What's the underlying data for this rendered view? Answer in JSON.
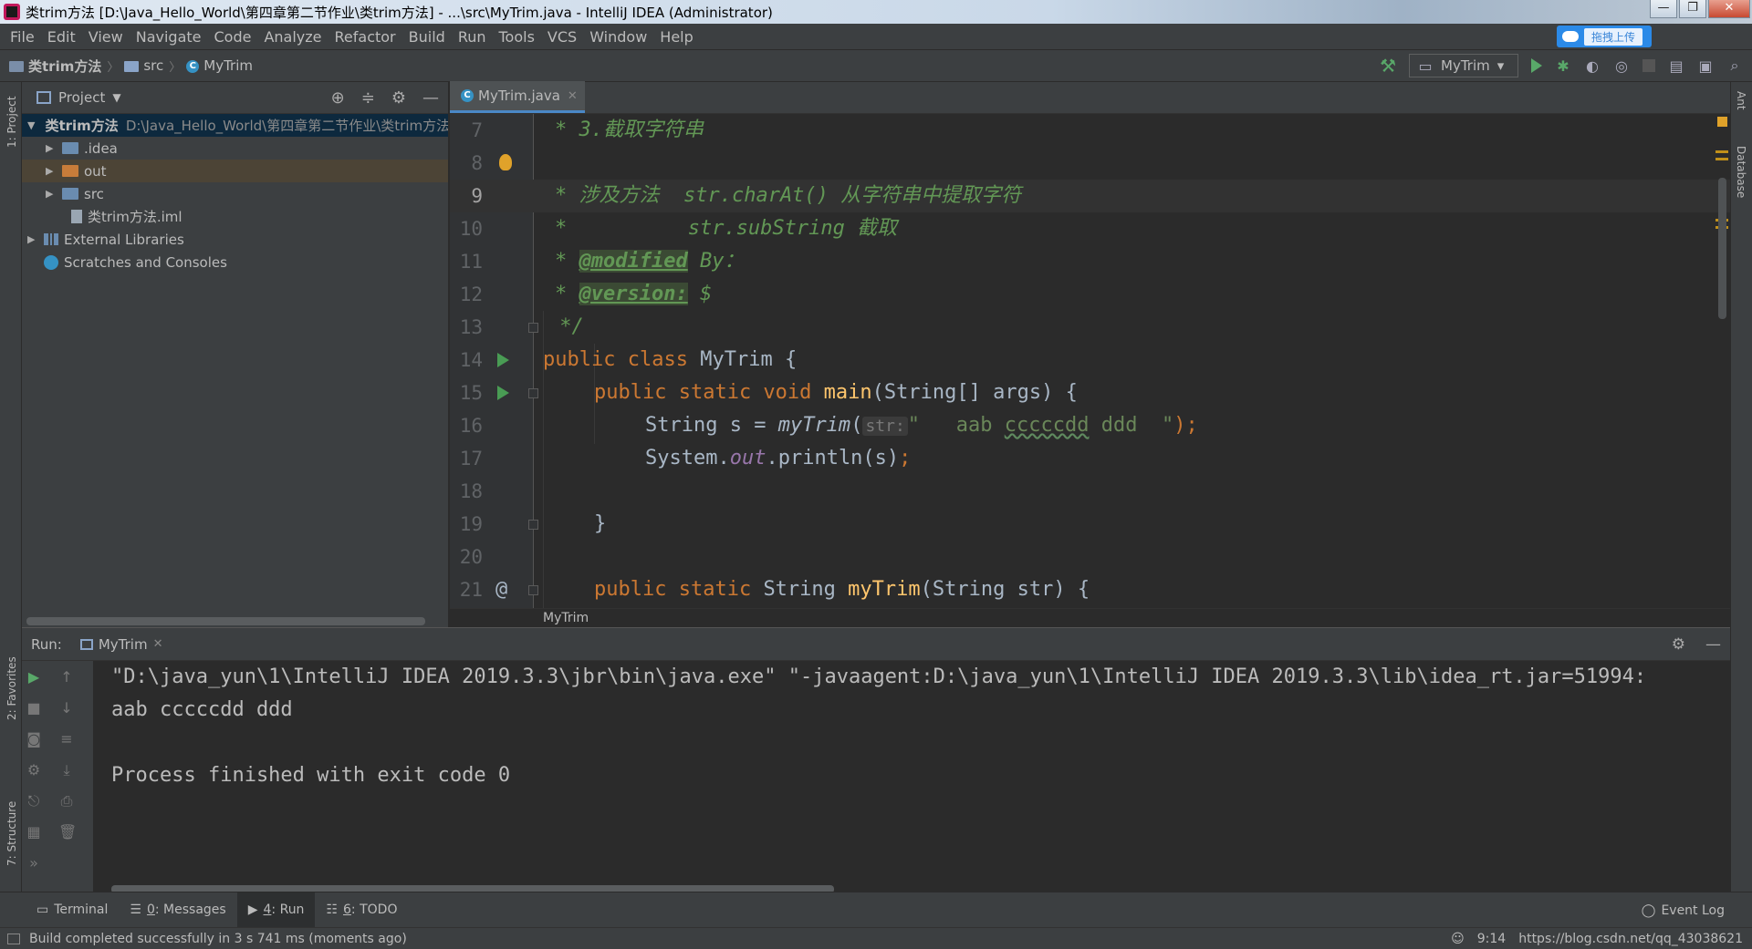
{
  "window": {
    "title": "类trim方法 [D:\\Java_Hello_World\\第四章第二节作业\\类trim方法] - ...\\src\\MyTrim.java - IntelliJ IDEA (Administrator)",
    "upload_badge": "拖拽上传",
    "controls": [
      "—",
      "❐",
      "✕"
    ]
  },
  "menu": [
    "File",
    "Edit",
    "View",
    "Navigate",
    "Code",
    "Analyze",
    "Refactor",
    "Build",
    "Run",
    "Tools",
    "VCS",
    "Window",
    "Help"
  ],
  "breadcrumb": {
    "project": "类trim方法",
    "folder": "src",
    "file": "MyTrim"
  },
  "toolbar": {
    "run_config": "MyTrim"
  },
  "left_strip": {
    "project": "1: Project",
    "favorites": "2: Favorites",
    "structure": "7: Structure"
  },
  "right_strip": {
    "ant": "Ant",
    "database": "Database"
  },
  "project_panel": {
    "title": "Project",
    "root": {
      "name": "类trim方法",
      "path": "D:\\Java_Hello_World\\第四章第二节作业\\类trim方法"
    },
    "items": [
      ".idea",
      "out",
      "src",
      "类trim方法.iml"
    ],
    "external_libraries": "External Libraries",
    "scratches": "Scratches and Consoles"
  },
  "editor": {
    "tab": "MyTrim.java",
    "crumb": "MyTrim",
    "line_numbers": [
      "7",
      "8",
      "9",
      "10",
      "11",
      "12",
      "13",
      "14",
      "15",
      "16",
      "17",
      "18",
      "19",
      "20",
      "21"
    ],
    "doc": {
      "l7": "* 3.截取字符串",
      "l9": "* 涉及方法  str.charAt() 从字符串中提取字符",
      "l10a": "*",
      "l10b": "          str.subString 截取",
      "l11a": "* ",
      "l11tag": "@modified",
      "l11b": " By：",
      "l12a": "* ",
      "l12tag": "@version:",
      "l12b": " $",
      "l13": " */"
    },
    "code": {
      "l14_kw1": "public",
      "l14_kw2": "class",
      "l14_name": "MyTrim",
      "l14_brace": "{",
      "l15_kw": "public static void",
      "l15_fn": "main",
      "l15_rest": "(String[] args) {",
      "l16_a": "String s = ",
      "l16_fn": "myTrim",
      "l16_p": "(",
      "l16_hint": "str:",
      "l16_str1": "\"   aab ",
      "l16_typo": "cccccdd",
      "l16_str2": " ddd  \"",
      "l16_end": ");",
      "l17_a": "System.",
      "l17_out": "out",
      "l17_b": ".println(s)",
      "l17_semi": ";",
      "l19": "}",
      "l21_kw": "public static",
      "l21_a": "String",
      "l21_fn": "myTrim",
      "l21_b": "(String str) {",
      "l21_gutter": "@"
    }
  },
  "run": {
    "label": "Run:",
    "tab": "MyTrim",
    "output": [
      "\"D:\\java_yun\\1\\IntelliJ IDEA 2019.3.3\\jbr\\bin\\java.exe\" \"-javaagent:D:\\java_yun\\1\\IntelliJ IDEA 2019.3.3\\lib\\idea_rt.jar=51994:",
      "aab cccccdd ddd",
      "",
      "Process finished with exit code 0"
    ]
  },
  "bottom_tools": [
    {
      "label": "Terminal"
    },
    {
      "num": "0",
      "label": ": Messages"
    },
    {
      "num": "4",
      "label": ": Run"
    },
    {
      "num": "6",
      "label": ": TODO"
    }
  ],
  "event_log": "Event Log",
  "status": {
    "message": "Build completed successfully in 3 s 741 ms (moments ago)",
    "position": "9:14",
    "url": "https://blog.csdn.net/qq_43038621"
  },
  "colors": {
    "accent": "#4a88c7",
    "run_green": "#59a869",
    "keyword": "#cc7832",
    "doc": "#629755"
  }
}
